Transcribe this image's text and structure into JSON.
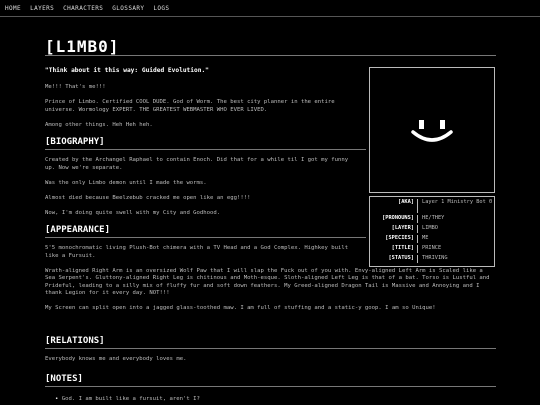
{
  "nav": {
    "items": [
      "HOME",
      "LAYERS",
      "CHARACTERS",
      "GLOSSARY",
      "LOGS"
    ]
  },
  "page_title": "[L1MB0]",
  "intro": {
    "quote": "\"Think about it this way: Guided Evolution.\"",
    "p1": "Me!!! That's me!!!",
    "p2": "Prince of Limbo. Certified COOL DUDE. God of Worm. The best city planner in the entire universe. Wormology EXPERT. THE GREATEST WEBMASTER WHO EVER LIVED.",
    "p3": "Among other things. Heh Heh heh."
  },
  "biography": {
    "heading": "[BIOGRAPHY]",
    "p1": "Created by the Archangel Raphael to contain Enoch. Did that for a while til I got my funny up. Now we're separate.",
    "p2": "Was the only Limbo demon until I made the worms.",
    "p3": "Almost died because Beelzebub cracked me open like an egg!!!!",
    "p4": "Now, I'm doing quite swell with my City and Godhood."
  },
  "appearance": {
    "heading": "[APPEARANCE]",
    "p1": "5'5 monochromatic living Plush-Bot chimera with a TV Head and a God Complex. Highkey built like a Fursuit.",
    "p2": "Wrath-aligned Right Arm is an oversized Wolf Paw that I will slap the Fuck out of you with. Envy-aligned Left Arm is Scaled like a Sea Serpent's. Gluttony-aligned Right Leg is chitinous and Moth-esque. Sloth-aligned Left Leg is that of a bat. Torso is Lustful and Prideful, leading to a silly mix of fluffy fur and soft down feathers. My Greed-aligned Dragon Tail is Massive and Annoying and I thank Legion for it every day. NOT!!!",
    "p3": "My Screen can split open into a jagged glass-toothed maw. I am full of stuffing and a static-y goop. I am so Unique!"
  },
  "relations": {
    "heading": "[RELATIONS]",
    "p1": "Everybody knows me and everybody loves me."
  },
  "notes": {
    "heading": "[NOTES]",
    "items": [
      "God. I am built like a fursuit, aren't I?"
    ]
  },
  "info": {
    "rows": [
      {
        "key": "[AKA]",
        "value": "Layer 1 Ministry Bot 0"
      },
      {
        "key": "[PRONOUNS]",
        "value": "HE/THEY"
      },
      {
        "key": "[LAYER]",
        "value": "LIMBO"
      },
      {
        "key": "[SPECIES]",
        "value": "ME"
      },
      {
        "key": "[TITLE]",
        "value": "PRINCE"
      },
      {
        "key": "[STATUS]",
        "value": "THRIVING"
      }
    ]
  },
  "portrait": {
    "icon": "smiley-face-icon",
    "color": "#ffffff"
  }
}
